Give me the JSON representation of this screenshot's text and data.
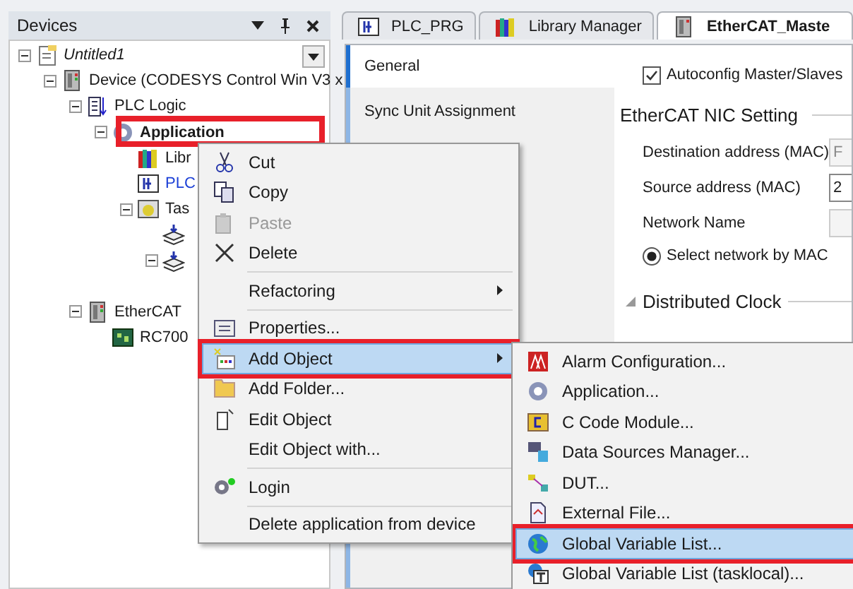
{
  "devices_panel": {
    "title": "Devices",
    "tree": [
      {
        "label": "Untitled1",
        "kind": "project",
        "expanded": true,
        "children": [
          {
            "label": "Device (CODESYS Control Win V3 x",
            "kind": "device",
            "expanded": true,
            "children": [
              {
                "label": "PLC Logic",
                "kind": "plc-logic",
                "expanded": true,
                "children": [
                  {
                    "label": "Application",
                    "kind": "application",
                    "expanded": true,
                    "children": [
                      {
                        "label": "Libr",
                        "kind": "library"
                      },
                      {
                        "label": "PLC",
                        "kind": "pou"
                      },
                      {
                        "label": "Tas",
                        "kind": "task-config",
                        "expanded": true,
                        "children": [
                          {
                            "kind": "task"
                          },
                          {
                            "kind": "task",
                            "expanded": true
                          }
                        ]
                      }
                    ]
                  }
                ]
              },
              {
                "label": "EtherCAT",
                "kind": "device",
                "expanded": true,
                "children": [
                  {
                    "label": "RC700",
                    "kind": "slave"
                  }
                ]
              }
            ]
          }
        ]
      }
    ]
  },
  "tabs": [
    {
      "label": "PLC_PRG",
      "selected": false
    },
    {
      "label": "Library Manager",
      "selected": false
    },
    {
      "label": "EtherCAT_Maste",
      "selected": true
    }
  ],
  "editor": {
    "side_tabs": [
      {
        "label": "General",
        "selected": true
      },
      {
        "label": "Sync Unit Assignment",
        "selected": false
      }
    ],
    "autoconfig": {
      "label": "Autoconfig Master/Slaves",
      "checked": true
    },
    "nic_section": "EtherCAT NIC Setting",
    "fields": [
      {
        "label": "Destination address (MAC)",
        "value": "F",
        "disabled": true
      },
      {
        "label": "Source address (MAC)",
        "value": "2",
        "disabled": false
      },
      {
        "label": "Network Name",
        "disabled": true
      }
    ],
    "radio": {
      "label": "Select network by MAC",
      "selected": true
    },
    "dc_section": "Distributed Clock"
  },
  "context_menu": [
    {
      "kind": "item",
      "label": "Cut",
      "disabled": false,
      "selected": false,
      "submenu": false
    },
    {
      "kind": "item",
      "label": "Copy",
      "disabled": false,
      "selected": false,
      "submenu": false
    },
    {
      "kind": "item",
      "label": "Paste",
      "disabled": true,
      "selected": false,
      "submenu": false
    },
    {
      "kind": "item",
      "label": "Delete",
      "disabled": false,
      "selected": false,
      "submenu": false
    },
    {
      "kind": "separator"
    },
    {
      "kind": "item",
      "label": "Refactoring",
      "disabled": false,
      "selected": false,
      "submenu": true
    },
    {
      "kind": "separator"
    },
    {
      "kind": "item",
      "label": "Properties...",
      "disabled": false,
      "selected": false,
      "submenu": false
    },
    {
      "kind": "item",
      "label": "Add Object",
      "disabled": false,
      "selected": true,
      "submenu": true
    },
    {
      "kind": "item",
      "label": "Add Folder...",
      "disabled": false,
      "selected": false,
      "submenu": false
    },
    {
      "kind": "item",
      "label": "Edit Object",
      "disabled": false,
      "selected": false,
      "submenu": false
    },
    {
      "kind": "item",
      "label": "Edit Object with...",
      "disabled": false,
      "selected": false,
      "submenu": false
    },
    {
      "kind": "separator"
    },
    {
      "kind": "item",
      "label": "Login",
      "disabled": false,
      "selected": false,
      "submenu": false
    },
    {
      "kind": "separator"
    },
    {
      "kind": "item",
      "label": "Delete application from device",
      "disabled": false,
      "selected": false,
      "submenu": false
    }
  ],
  "submenu": [
    {
      "label": "Alarm Configuration...",
      "selected": false
    },
    {
      "label": "Application...",
      "selected": false
    },
    {
      "label": "C Code Module...",
      "selected": false
    },
    {
      "label": "Data Sources Manager...",
      "selected": false
    },
    {
      "label": "DUT...",
      "selected": false
    },
    {
      "label": "External File...",
      "selected": false
    },
    {
      "label": "Global Variable List...",
      "selected": true
    },
    {
      "label": "Global Variable List (tasklocal)...",
      "selected": false
    }
  ]
}
